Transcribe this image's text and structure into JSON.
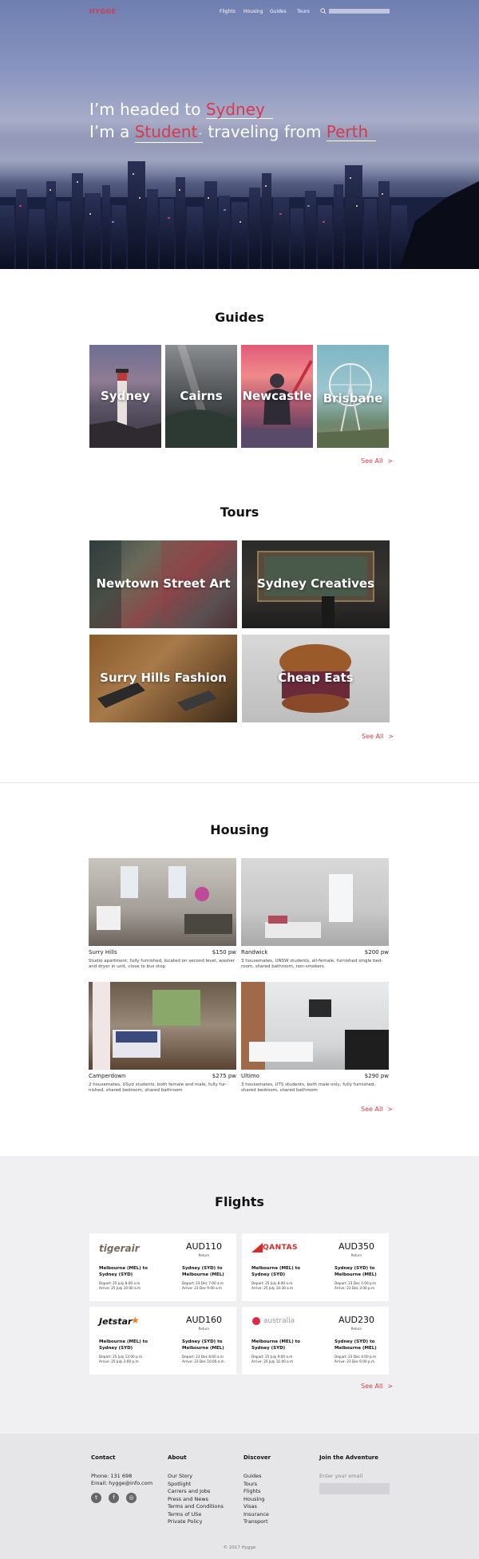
{
  "nav": {
    "logo": "HYGGE",
    "links": [
      "Flights",
      "Housing",
      "Guides",
      "Tours"
    ]
  },
  "hero": {
    "line1_prefix": "I’m headed to",
    "destination": "Sydney",
    "line2_prefix": "I’m a",
    "role": "Student",
    "line2_middle": "traveling from",
    "origin": "Perth"
  },
  "guides": {
    "title": "Guides",
    "cards": [
      "Sydney",
      "Cairns",
      "Newcastle",
      "Brisbane"
    ],
    "see_all": "See All",
    "see_all_chev": ">"
  },
  "tours": {
    "title": "Tours",
    "cards": [
      "Newtown Street Art",
      "Sydney Creatives",
      "Surry Hills Fashion",
      "Cheap Eats"
    ],
    "see_all": "See All",
    "see_all_chev": ">"
  },
  "housing": {
    "title": "Housing",
    "listings": [
      {
        "suburb": "Surry Hills",
        "price": "$150 pw",
        "desc": "Studio apartment, fully furnished, located on second level, washer and dryer in unit, close to bus stop"
      },
      {
        "suburb": "Randwick",
        "price": "$200 pw",
        "desc": "3 housemates, UNSW students, all-female, furnished single bed-room, shared bathroom, non-smokers"
      },
      {
        "suburb": "Camperdown",
        "price": "$275 pw",
        "desc": "2 housemates, USyd students, both female and male, fully fur-nished, shared bedroom, shared bathroom"
      },
      {
        "suburb": "Ultimo",
        "price": "$290 pw",
        "desc": "3 housemates, UTS students, both male only, fully furnished, shared bedroom, shared bathroom"
      }
    ],
    "see_all": "See All",
    "see_all_chev": ">"
  },
  "flights": {
    "title": "Flights",
    "cards": [
      {
        "airline": "tigerair",
        "price": "AUD110",
        "type": "Return",
        "out_route": "Melbourne (MEL) to Sydney (SYD)",
        "out_depart": "Depart: 25 July 8:00 a.m",
        "out_arrive": "Arrive: 25 July 10:00 a.m",
        "ret_route": "Sydney (SYD) to Melbourne (MEL)",
        "ret_depart": "Depart: 23 Dec 7:00 a.m",
        "ret_arrive": "Arrive: 23 Dec 9:00 a.m"
      },
      {
        "airline": "QANTAS",
        "price": "AUD350",
        "type": "Return",
        "out_route": "Melbourne (MEL) to Sydney (SYD)",
        "out_depart": "Depart: 25 July 8:00 a.m",
        "out_arrive": "Arrive: 25 July 10:30 a.m",
        "ret_route": "Sydney (SYD) to Melbourne (MEL)",
        "ret_depart": "Depart: 23 Dec 1:00 p.m",
        "ret_arrive": "Arrive: 23 Dec 3:00 p.m"
      },
      {
        "airline": "Jetstar",
        "price": "AUD160",
        "type": "Return",
        "out_route": "Melbourne (MEL) to Sydney (SYD)",
        "out_depart": "Depart: 25 July 12:00 p.m",
        "out_arrive": "Arrive: 25 July 2:00 p.m",
        "ret_route": "Sydney (SYD) to Melbourne (MEL)",
        "ret_depart": "Depart: 23 Dec 8:00 a.m",
        "ret_arrive": "Arrive: 23 Dec 10:00 a.m"
      },
      {
        "airline": "australia",
        "price": "AUD230",
        "type": "Return",
        "out_route": "Melbourne (MEL) to Sydney (SYD)",
        "out_depart": "Depart: 25 July 9:00 a.m",
        "out_arrive": "Arrive: 25 July 11:00 a.m",
        "ret_route": "Sydney (SYD) to Melbourne (MEL)",
        "ret_depart": "Depart: 23 Dec 4:00 p.m",
        "ret_arrive": "Arrive: 23 Dec 6:00 p.m"
      }
    ],
    "see_all": "See All",
    "see_all_chev": ">"
  },
  "footer": {
    "contact": {
      "title": "Contact",
      "phone": "Phone: 131 698",
      "email": "Email: hygge@info.com"
    },
    "about": {
      "title": "About",
      "links": [
        "Our Story",
        "Spotlight",
        "Carrers and Jobs",
        "Press and News",
        "Terms and Conditions",
        "Terms of USe",
        "Private Policy"
      ]
    },
    "discover": {
      "title": "Discover",
      "links": [
        "Guides",
        "Tours",
        "Flights",
        "Housing",
        "Visas",
        "Insurance",
        "Transport"
      ]
    },
    "join": {
      "title": "Join the Adventure",
      "placeholder": "Enter your email"
    },
    "copyright": "© 2017 Hygge"
  }
}
